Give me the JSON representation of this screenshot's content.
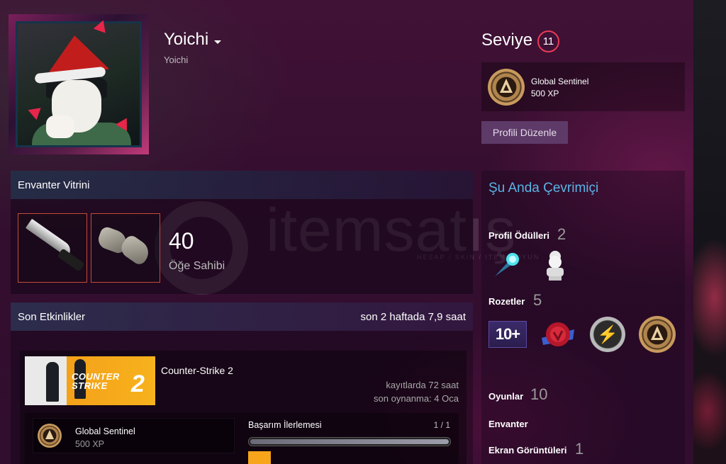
{
  "profile": {
    "persona_name": "Yoichi",
    "real_name": "Yoichi"
  },
  "level": {
    "label": "Seviye",
    "value": "11"
  },
  "xp_badge": {
    "name": "Global Sentinel",
    "xp": "500 XP"
  },
  "edit_profile_label": "Profili Düzenle",
  "showcase": {
    "title": "Envanter Vitrini",
    "items": [
      "knife-icon",
      "gloves-icon"
    ],
    "count": "40",
    "count_label": "Öğe Sahibi"
  },
  "activity": {
    "title": "Son Etkinlikler",
    "summary": "son 2 haftada 7,9 saat",
    "game": {
      "capsule_title_line1": "COUNTER",
      "capsule_title_line2": "STRIKE",
      "capsule_number": "2",
      "name": "Counter-Strike 2",
      "hours": "kayıtlarda 72 saat",
      "last_played": "son oynanma: 4 Oca"
    },
    "achievement": {
      "name": "Global Sentinel",
      "xp": "500 XP",
      "progress_label": "Başarım İlerlemesi",
      "progress_count": "1 / 1",
      "progress_fraction": 1.0
    }
  },
  "sidebar": {
    "status": "Şu Anda Çevrimiçi",
    "awards_label": "Profil Ödülleri",
    "awards_count": "2",
    "badges_label": "Rozetler",
    "badges_count": "5",
    "badge_10_text": "10+",
    "games_label": "Oyunlar",
    "games_count": "10",
    "inventory_label": "Envanter",
    "screenshots_label": "Ekran Görüntüleri",
    "screenshots_count": "1"
  },
  "watermark": {
    "brand": "itemsatış",
    "tagline": "HESAP / SKIN / ITEM / OYUN"
  },
  "colors": {
    "level_ring": "#e83b56",
    "online": "#5bb4e6",
    "slot_border": "#c74a3a",
    "edit_button": "#5e3a68"
  }
}
